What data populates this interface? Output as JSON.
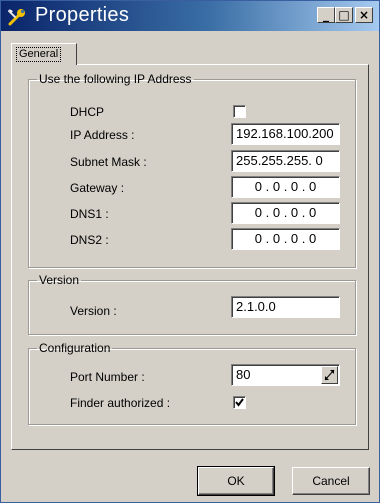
{
  "window": {
    "title": "Properties",
    "minimize_glyph": "_",
    "maximize_glyph": "□",
    "close_glyph": "×"
  },
  "tabs": [
    {
      "label": "General",
      "selected": true
    }
  ],
  "ip_group": {
    "legend": "Use the following IP Address",
    "dhcp_label": "DHCP",
    "dhcp_checked": false,
    "ip_label": "IP Address :",
    "ip_value": "192.168.100.200",
    "subnet_label": "Subnet Mask :",
    "subnet_value": "255.255.255.  0",
    "gateway_label": "Gateway :",
    "gateway_value": "0  .  0  .  0  .  0",
    "dns1_label": "DNS1 :",
    "dns1_value": "0  .  0  .  0  .  0",
    "dns2_label": "DNS2 :",
    "dns2_value": "0  .  0  .  0  .  0"
  },
  "version_group": {
    "legend": "Version",
    "version_label": "Version :",
    "version_value": "2.1.0.0"
  },
  "config_group": {
    "legend": "Configuration",
    "port_label": "Port Number :",
    "port_value": "80",
    "finder_label": "Finder authorized :",
    "finder_checked": true
  },
  "buttons": {
    "ok": "OK",
    "cancel": "Cancel"
  },
  "icons": {
    "app": "properties-wrench-icon",
    "spin": "spin-arrows-icon",
    "check": "checkmark-icon"
  },
  "colors": {
    "titlebar_start": "#0a246a",
    "titlebar_end": "#a6caf0",
    "face": "#d4d0c8"
  }
}
